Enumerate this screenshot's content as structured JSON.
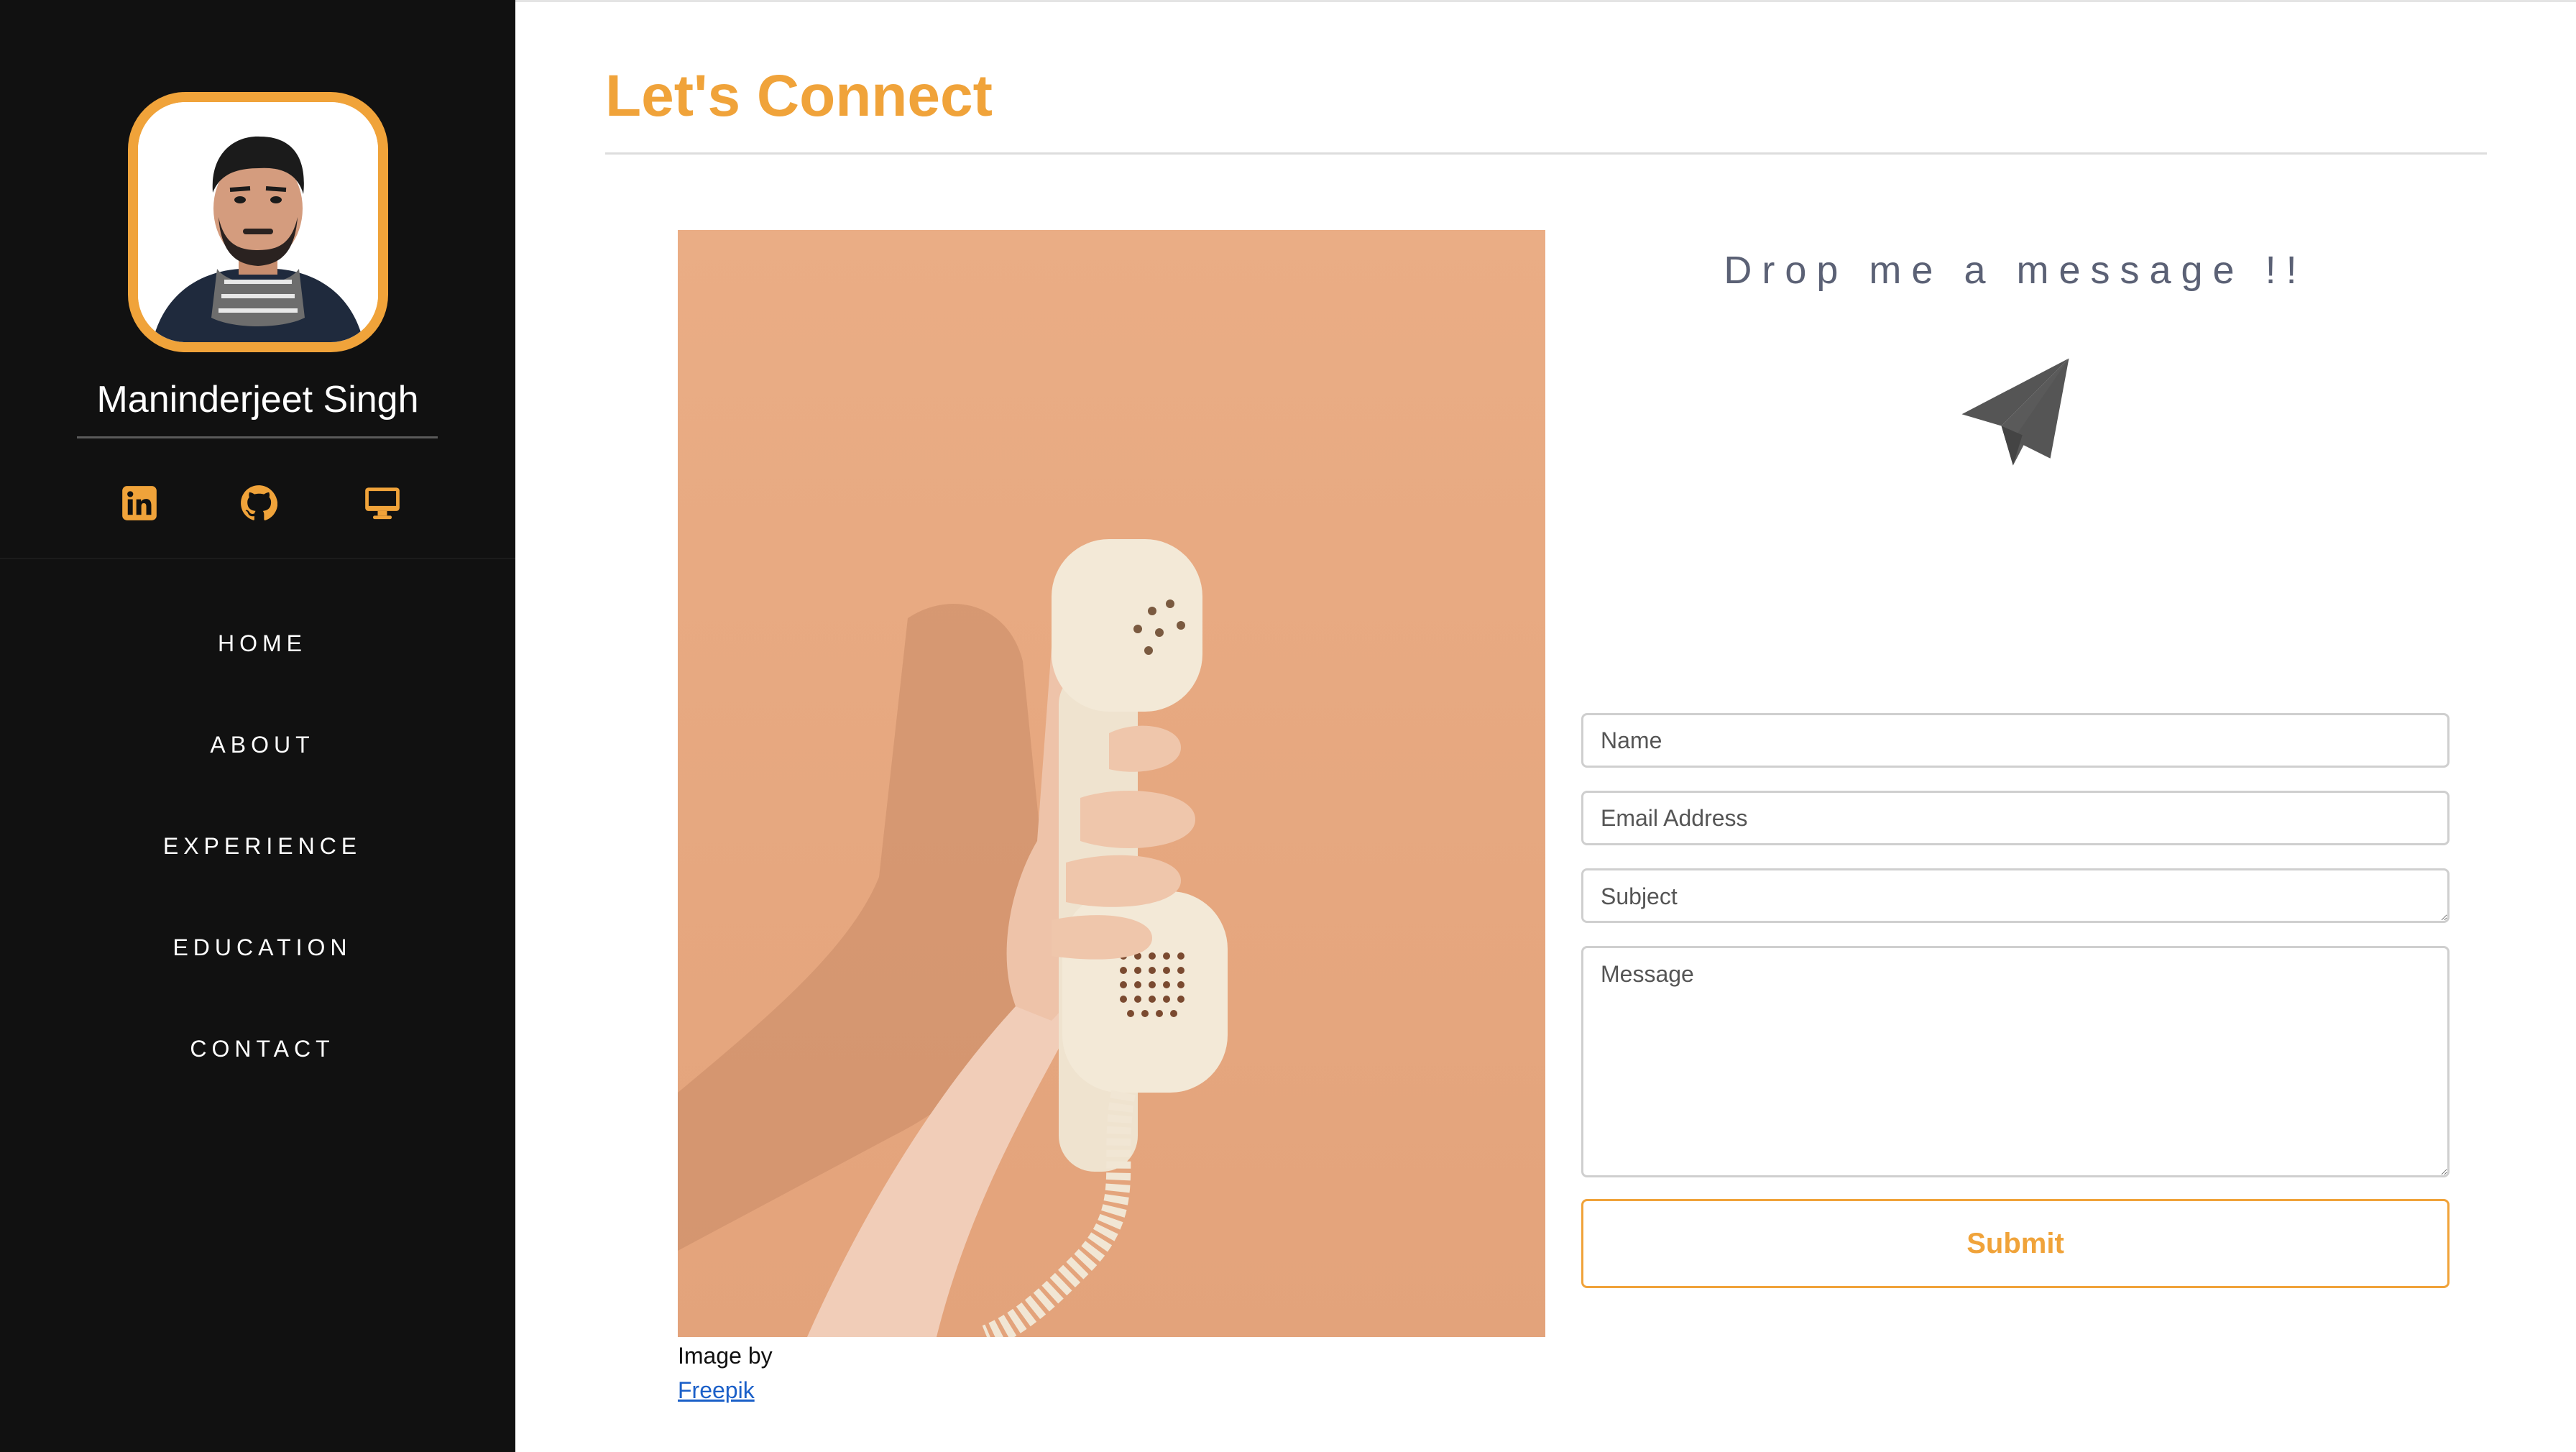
{
  "sidebar": {
    "name": "Maninderjeet Singh",
    "socials": [
      {
        "icon": "linkedin-icon"
      },
      {
        "icon": "github-icon"
      },
      {
        "icon": "desktop-icon"
      }
    ],
    "nav": [
      "HOME",
      "ABOUT",
      "EXPERIENCE",
      "EDUCATION",
      "CONTACT"
    ]
  },
  "main": {
    "title": "Let's Connect",
    "image_credit": {
      "text": "Image by",
      "link": "Freepik"
    },
    "contact": {
      "heading": "Drop me a message !!",
      "icon": "paper-plane-icon",
      "fields": {
        "name_placeholder": "Name",
        "email_placeholder": "Email Address",
        "subject_placeholder": "Subject",
        "message_placeholder": "Message"
      },
      "submit_label": "Submit"
    }
  },
  "colors": {
    "accent": "#f0a33a",
    "sidebar_bg": "#111111",
    "heading_text": "#5b6175",
    "link": "#1a5fc8"
  }
}
